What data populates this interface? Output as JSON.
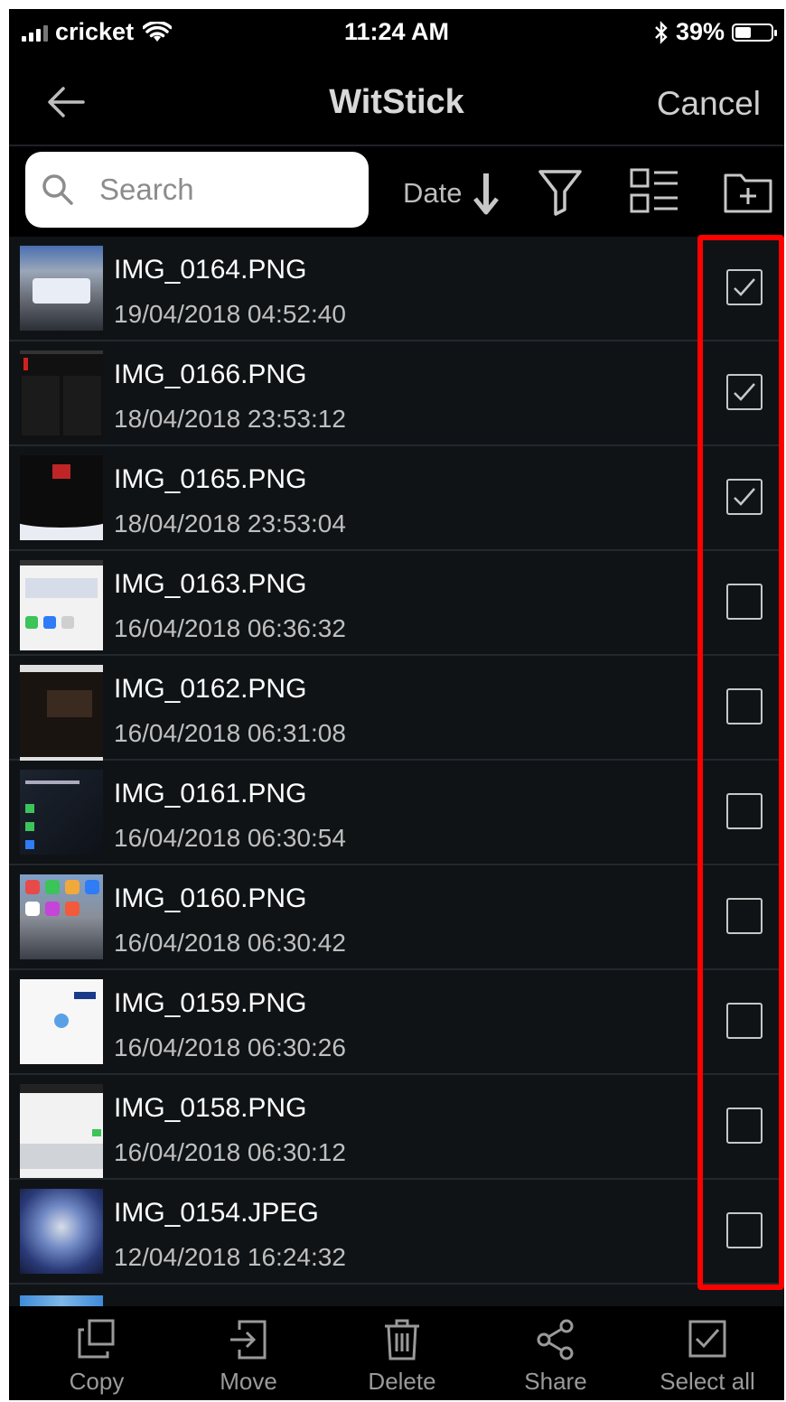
{
  "status_bar": {
    "carrier": "cricket",
    "time": "11:24 AM",
    "battery": "39%",
    "battery_level": 0.39,
    "icons": [
      "signal-icon",
      "wifi-icon",
      "bluetooth-icon",
      "battery-icon"
    ]
  },
  "nav": {
    "title": "WitStick",
    "cancel": "Cancel",
    "back_icon": "back-arrow-icon"
  },
  "toolbar": {
    "search_placeholder": "Search",
    "sort_label": "Date",
    "icons": [
      "sort-descending-icon",
      "filter-icon",
      "view-toggle-icon",
      "new-folder-icon"
    ]
  },
  "files": [
    {
      "name": "IMG_0164.PNG",
      "date": "19/04/2018 04:52:40",
      "checked": true
    },
    {
      "name": "IMG_0166.PNG",
      "date": "18/04/2018 23:53:12",
      "checked": true
    },
    {
      "name": "IMG_0165.PNG",
      "date": "18/04/2018 23:53:04",
      "checked": true
    },
    {
      "name": "IMG_0163.PNG",
      "date": "16/04/2018 06:36:32",
      "checked": false
    },
    {
      "name": "IMG_0162.PNG",
      "date": "16/04/2018 06:31:08",
      "checked": false
    },
    {
      "name": "IMG_0161.PNG",
      "date": "16/04/2018 06:30:54",
      "checked": false
    },
    {
      "name": "IMG_0160.PNG",
      "date": "16/04/2018 06:30:42",
      "checked": false
    },
    {
      "name": "IMG_0159.PNG",
      "date": "16/04/2018 06:30:26",
      "checked": false
    },
    {
      "name": "IMG_0158.PNG",
      "date": "16/04/2018 06:30:12",
      "checked": false
    },
    {
      "name": "IMG_0154.JPEG",
      "date": "12/04/2018 16:24:32",
      "checked": false
    }
  ],
  "bottom_bar": {
    "items": [
      {
        "label": "Copy",
        "icon": "copy-icon"
      },
      {
        "label": "Move",
        "icon": "move-icon"
      },
      {
        "label": "Delete",
        "icon": "trash-icon"
      },
      {
        "label": "Share",
        "icon": "share-icon"
      },
      {
        "label": "Select all",
        "icon": "select-all-icon"
      }
    ]
  },
  "colors": {
    "background": "#0f1214",
    "bar": "#000000",
    "highlight": "#ff0000",
    "secondary_text": "#bfbfbf"
  }
}
